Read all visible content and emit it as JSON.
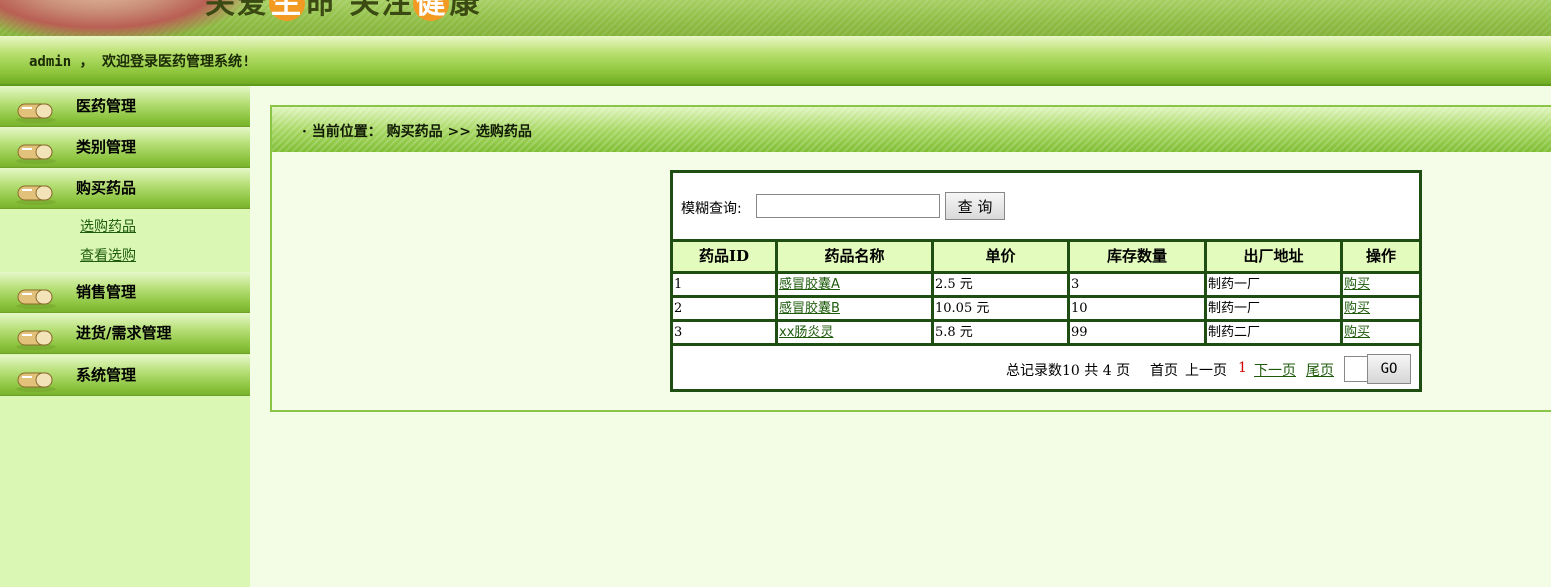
{
  "banner": {
    "slogan_a": "关爱",
    "slogan_hl1": "生",
    "slogan_b": "命 关注",
    "slogan_hl2": "健",
    "slogan_c": "康"
  },
  "welcome": "admin ， 欢迎登录医药管理系统!",
  "sidebar": {
    "items": [
      {
        "label": "医药管理"
      },
      {
        "label": "类别管理"
      },
      {
        "label": "购买药品"
      },
      {
        "label": "销售管理"
      },
      {
        "label": "进货/需求管理"
      },
      {
        "label": "系统管理"
      }
    ],
    "sub_items": [
      {
        "label": "选购药品"
      },
      {
        "label": "查看选购"
      }
    ]
  },
  "breadcrumb": "· 当前位置： 购买药品 >> 选购药品",
  "search": {
    "label": "模糊查询:",
    "value": "",
    "button": "查 询"
  },
  "table": {
    "headers": [
      "药品ID",
      "药品名称",
      "单价",
      "库存数量",
      "出厂地址",
      "操作"
    ],
    "rows": [
      [
        "1",
        "感冒胶囊A",
        "2.5 元",
        "3",
        "制药一厂",
        "购买"
      ],
      [
        "2",
        "感冒胶囊B",
        "10.05 元",
        "10",
        "制药一厂",
        "购买"
      ],
      [
        "3",
        "xx肠炎灵",
        "5.8 元",
        "99",
        "制药二厂",
        "购买"
      ]
    ]
  },
  "pager": {
    "summary": "总记录数10 共 4 页",
    "first": "首页",
    "prev": "上一页",
    "current": "1",
    "next": "下一页",
    "last": "尾页",
    "go": "GO",
    "current_color": "#d40000"
  }
}
